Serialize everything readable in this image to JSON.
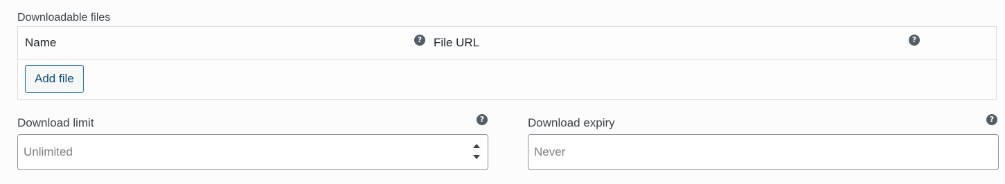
{
  "downloadable_files": {
    "label": "Downloadable files",
    "columns": {
      "name": "Name",
      "file_url": "File URL"
    },
    "help_icon": "question-circle-icon",
    "add_file_label": "Add file"
  },
  "download_limit": {
    "label": "Download limit",
    "placeholder": "Unlimited",
    "value": "",
    "help_icon": "question-circle-icon"
  },
  "download_expiry": {
    "label": "Download expiry",
    "placeholder": "Never",
    "value": "",
    "help_icon": "question-circle-icon"
  },
  "colors": {
    "button_border": "#2271b1",
    "button_text": "#0a4b78",
    "help_icon_bg": "#555d66"
  }
}
